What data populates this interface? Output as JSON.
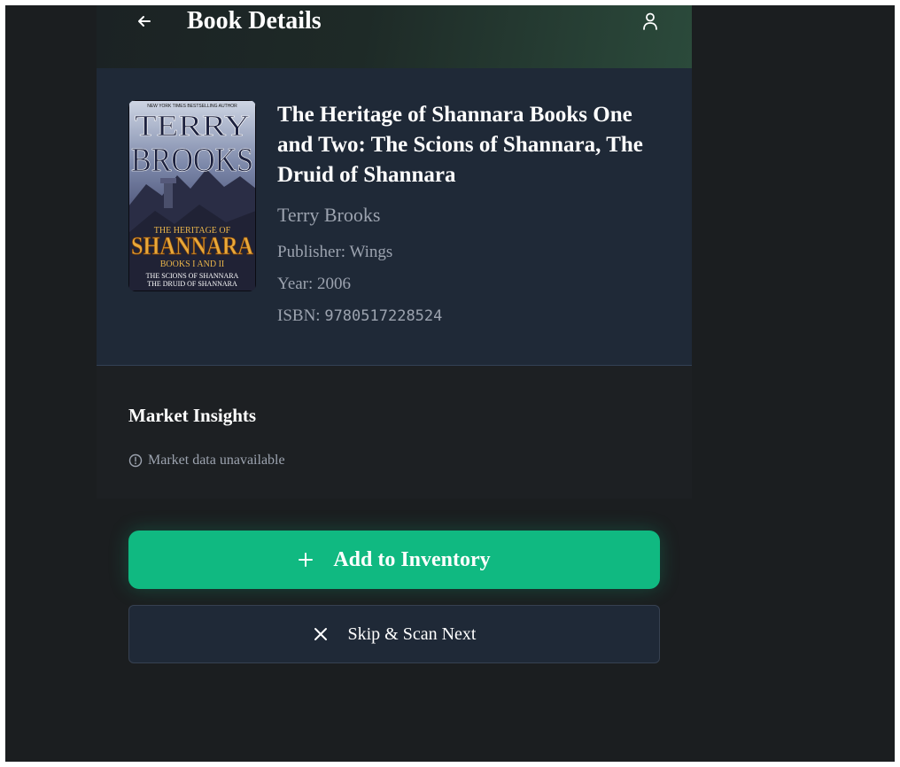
{
  "header": {
    "title": "Book Details",
    "back_icon": "arrow-left-icon",
    "profile_icon": "user-icon"
  },
  "book": {
    "title": "The Heritage of Shannara Books One and Two: The Scions of Shannara, The Druid of Shannara",
    "author": "Terry Brooks",
    "publisher_label": "Publisher:",
    "publisher": "Wings",
    "year_label": "Year:",
    "year": "2006",
    "isbn_label": "ISBN:",
    "isbn": "9780517228524",
    "cover": {
      "top_line": "NEW YORK TIMES BESTSELLING AUTHOR",
      "author_first": "TERRY",
      "author_last": "BROOKS",
      "series_pre": "THE HERITAGE OF",
      "series": "SHANNARA",
      "books": "BOOKS I AND II",
      "sub1": "THE SCIONS OF SHANNARA",
      "sub2": "THE DRUID OF SHANNARA"
    }
  },
  "insights": {
    "title": "Market Insights",
    "note": "Market data unavailable",
    "note_icon": "alert-circle-icon"
  },
  "actions": {
    "add_label": "Add to Inventory",
    "add_icon": "plus-icon",
    "skip_label": "Skip & Scan Next",
    "skip_icon": "close-icon"
  },
  "colors": {
    "accent": "#10b981",
    "card_bg": "#1f2937",
    "page_bg": "#1b1e20"
  }
}
